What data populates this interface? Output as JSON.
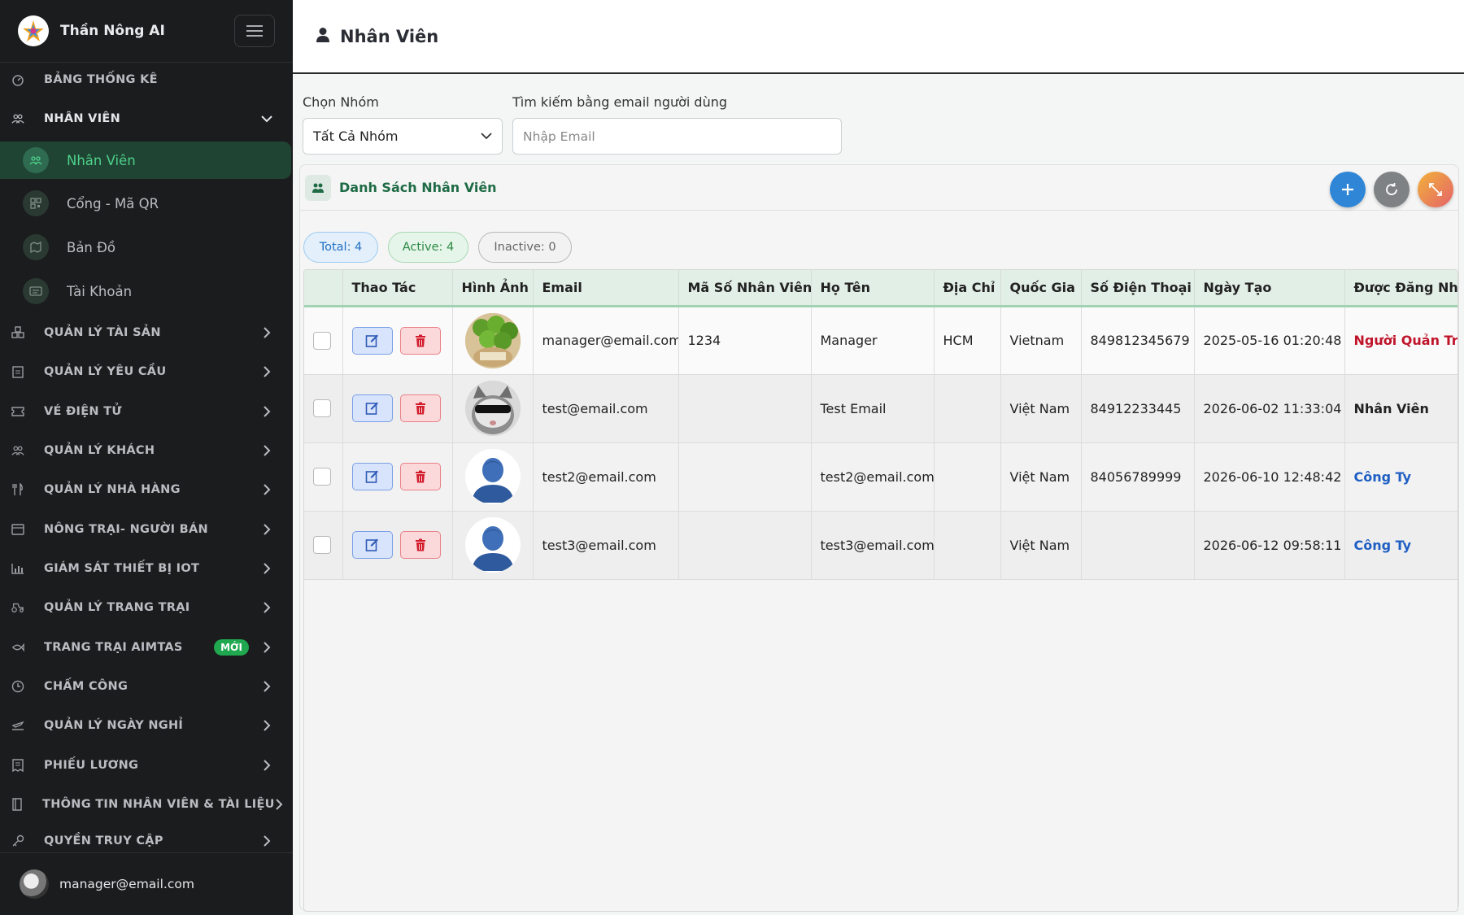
{
  "app": {
    "brand_name": "Thần Nông AI",
    "user_email": "manager@email.com"
  },
  "sidebar": {
    "dashboard": "BẢNG THỐNG KÊ",
    "staff_group": "NHÂN VIÊN",
    "sub_items": [
      "Nhân Viên",
      "Cổng - Mã QR",
      "Bản Đồ",
      "Tài Khoản"
    ],
    "items": [
      "QUẢN LÝ TÀI SẢN",
      "QUẢN LÝ YÊU CẦU",
      "VÉ ĐIỆN TỬ",
      "QUẢN LÝ KHÁCH",
      "QUẢN LÝ NHÀ HÀNG",
      "NÔNG TRẠI- NGƯỜI BÁN",
      "GIÁM SÁT THIẾT BỊ IOT",
      "QUẢN LÝ TRANG TRẠI",
      "TRANG TRẠI AIMTAS",
      "CHẤM CÔNG",
      "QUẢN LÝ NGÀY NGHỈ",
      "PHIẾU LƯƠNG",
      "THÔNG TIN NHÂN VIÊN & TÀI LIỆU",
      "QUYỀN TRUY CẬP"
    ],
    "new_badge": "MỚI"
  },
  "header": {
    "title": "Nhân Viên"
  },
  "filters": {
    "group_label": "Chọn Nhóm",
    "group_value": "Tất Cả Nhóm",
    "search_label": "Tìm kiếm bằng email người dùng",
    "search_placeholder": "Nhập Email",
    "search_value": ""
  },
  "card": {
    "title": "Danh Sách Nhân Viên",
    "chips": {
      "total": "Total: 4",
      "active": "Active: 4",
      "inactive": "Inactive: 0"
    }
  },
  "table": {
    "columns": [
      "Thao Tác",
      "Hình Ảnh",
      "Email",
      "Mã Số Nhân Viên",
      "Họ Tên",
      "Địa Chỉ",
      "Quốc Gia",
      "Số Điện Thoại",
      "Ngày Tạo",
      "Được Đăng Nhậ"
    ],
    "rows": [
      {
        "email": "manager@email.com",
        "code": "1234",
        "name": "Manager",
        "address": "HCM",
        "country": "Vietnam",
        "phone": "849812345679",
        "created": "2025-05-16 01:20:48",
        "role": "Người Quản Trị",
        "image": "lime-basket"
      },
      {
        "email": "test@email.com",
        "code": "",
        "name": "Test Email",
        "address": "",
        "country": "Việt Nam",
        "phone": "84912233445",
        "created": "2026-06-02 11:33:04",
        "role": "Nhân Viên",
        "image": "cat-sunglasses"
      },
      {
        "email": "test2@email.com",
        "code": "",
        "name": "test2@email.com",
        "address": "",
        "country": "Việt Nam",
        "phone": "84056789999",
        "created": "2026-06-10 12:48:42",
        "role": "Công Ty",
        "image": "default-avatar"
      },
      {
        "email": "test3@email.com",
        "code": "",
        "name": "test3@email.com",
        "address": "",
        "country": "Việt Nam",
        "phone": "",
        "created": "2026-06-12 09:58:11",
        "role": "Công Ty",
        "image": "default-avatar"
      }
    ]
  },
  "colors": {
    "sidebar_bg": "#1b1c1d",
    "active_green": "#4ed08a",
    "header_green": "#e2efe6",
    "admin_red": "#c0142a",
    "company_blue": "#1f5fc4"
  }
}
